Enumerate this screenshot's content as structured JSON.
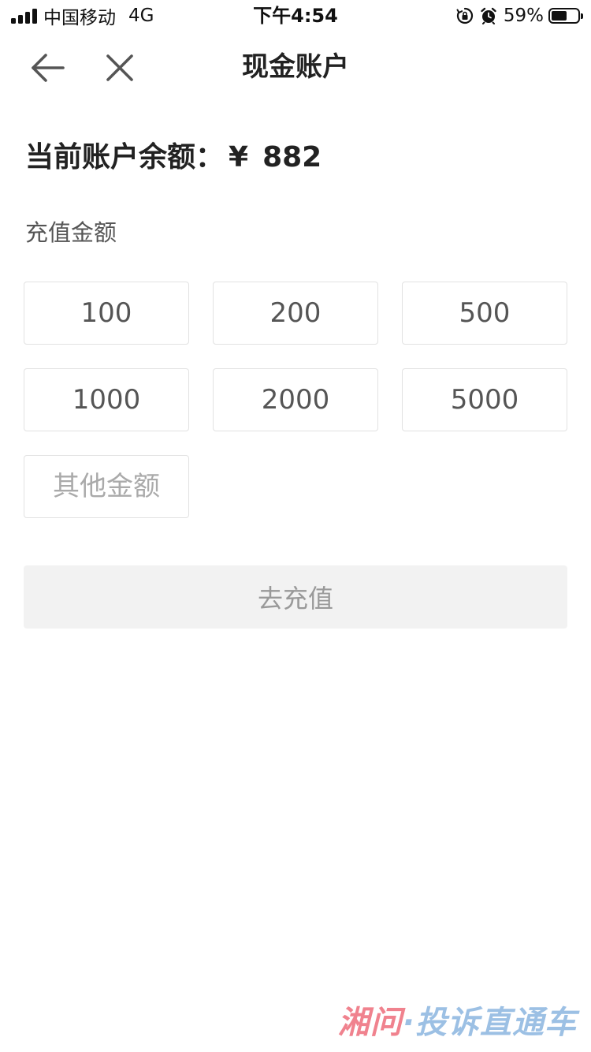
{
  "status_bar": {
    "carrier": "中国移动",
    "network": "4G",
    "time": "下午4:54",
    "battery_percent": "59%",
    "battery_level": 0.59,
    "icons": [
      "signal-icon",
      "orientation-lock-icon",
      "alarm-icon",
      "battery-icon"
    ]
  },
  "nav": {
    "title": "现金账户",
    "back_icon": "arrow-left-icon",
    "close_icon": "close-icon"
  },
  "balance": {
    "label": "当前账户余额：",
    "currency": "¥",
    "amount": "882"
  },
  "recharge": {
    "label": "充值金额",
    "options": [
      "100",
      "200",
      "500",
      "1000",
      "2000",
      "5000"
    ],
    "other_placeholder": "其他金额",
    "other_value": ""
  },
  "submit": {
    "label": "去充值"
  },
  "watermark": {
    "part1": "湘问",
    "dot": "·",
    "part2": "投诉直通车"
  }
}
